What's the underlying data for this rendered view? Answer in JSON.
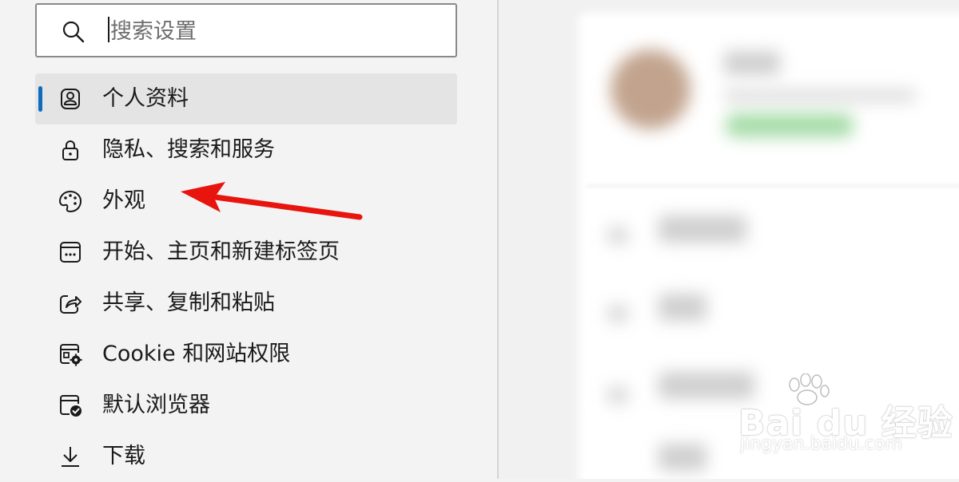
{
  "search": {
    "placeholder": "搜索设置",
    "value": ""
  },
  "sidebar": {
    "items": [
      {
        "label": "个人资料",
        "icon": "profile-icon",
        "active": true
      },
      {
        "label": "隐私、搜索和服务",
        "icon": "lock-icon",
        "active": false
      },
      {
        "label": "外观",
        "icon": "palette-icon",
        "active": false
      },
      {
        "label": "开始、主页和新建标签页",
        "icon": "new-tab-icon",
        "active": false
      },
      {
        "label": "共享、复制和粘贴",
        "icon": "share-icon",
        "active": false
      },
      {
        "label": "Cookie 和网站权限",
        "icon": "site-permissions-icon",
        "active": false
      },
      {
        "label": "默认浏览器",
        "icon": "default-browser-icon",
        "active": false
      },
      {
        "label": "下载",
        "icon": "download-icon",
        "active": false
      }
    ]
  },
  "annotation": {
    "arrow_color": "#e8140e",
    "target": "外观"
  },
  "watermark": {
    "logo": "Bai du 经验",
    "url": "jingyan.baidu.com"
  },
  "colors": {
    "accent": "#0f6cbd",
    "active_bg": "#e4e4e4",
    "sidebar_bg": "#f3f3f3"
  }
}
